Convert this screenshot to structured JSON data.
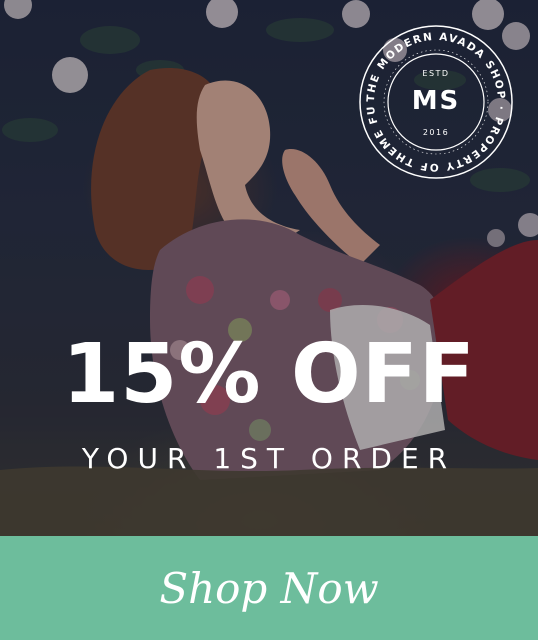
{
  "badge": {
    "ring_text": "THE MODERN AVADA SHOP · PROPERTY OF THEME FUSION ·",
    "estd": "ESTD",
    "monogram": "MS",
    "year": "2016"
  },
  "promo": {
    "headline": "15% OFF",
    "subheadline": "YOUR 1ST ORDER",
    "cta_label": "Shop Now"
  },
  "colors": {
    "cta_background": "#6dbd9c",
    "overlay": "#1f2437",
    "text": "#ffffff"
  },
  "image": {
    "subject": "woman with auburn hair reclining in grass among roses, wearing floral jacket and red trousers"
  }
}
